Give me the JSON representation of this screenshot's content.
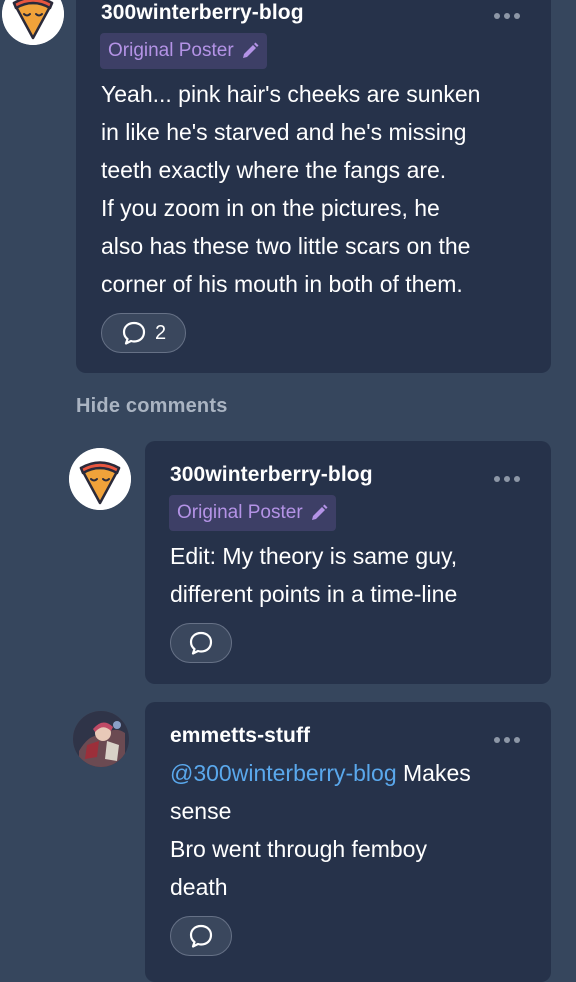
{
  "colors": {
    "page_bg": "#36465d",
    "card_bg": "#26324a",
    "badge_bg": "#3d3f66",
    "badge_text": "#b493e6",
    "mention": "#5aa8ec",
    "muted_text": "#aab4c2"
  },
  "post": {
    "username": "300winterberry-blog",
    "badge": "Original Poster",
    "text": "Yeah... pink hair's cheeks are sunken\nin like he's starved and he's missing\nteeth exactly where the fangs are.\nIf you zoom in on the pictures, he\nalso has these two little scars on the\ncorner of his mouth in both of them.",
    "reply_count": "2",
    "avatar_icon": "pizza-slice-avatar",
    "more_icon": "more-dots-icon",
    "reply_icon": "speech-bubble-icon"
  },
  "hide_comments_label": "Hide comments",
  "comments": [
    {
      "username": "300winterberry-blog",
      "badge": "Original Poster",
      "text": "Edit: My theory is same guy,\ndifferent points in a time-line",
      "avatar_icon": "pizza-slice-avatar"
    },
    {
      "username": "emmetts-stuff",
      "mention": "@300winterberry-blog",
      "text_after_mention": " Makes",
      "text": "sense\nBro went through femboy\ndeath",
      "avatar_icon": "character-art-avatar"
    }
  ]
}
